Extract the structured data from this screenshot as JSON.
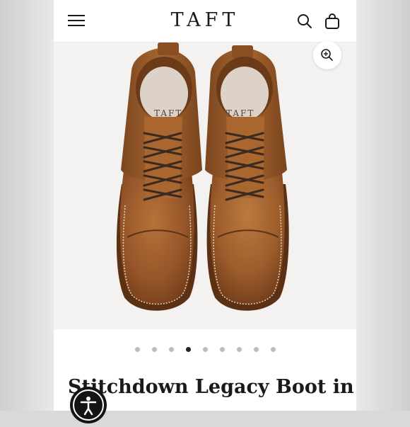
{
  "header": {
    "logo_text": "TAFT",
    "menu_icon": "hamburger-menu-icon",
    "search_icon": "search-icon",
    "cart_icon": "shopping-bag-icon"
  },
  "gallery": {
    "image_description": "Pair of brown leather lace-up cap-toe boots viewed from above",
    "insole_brand_text": "TAFT",
    "zoom_icon": "zoom-in-icon",
    "slide_count": 9,
    "active_slide": 4
  },
  "product": {
    "title": "Stitchdown Legacy Boot in"
  },
  "accessibility": {
    "icon": "accessibility-icon"
  },
  "colors": {
    "leather": "#9a5a2a",
    "header_text": "#1a1a1a",
    "dot_inactive": "#bdbdbd",
    "dot_active": "#222222"
  }
}
